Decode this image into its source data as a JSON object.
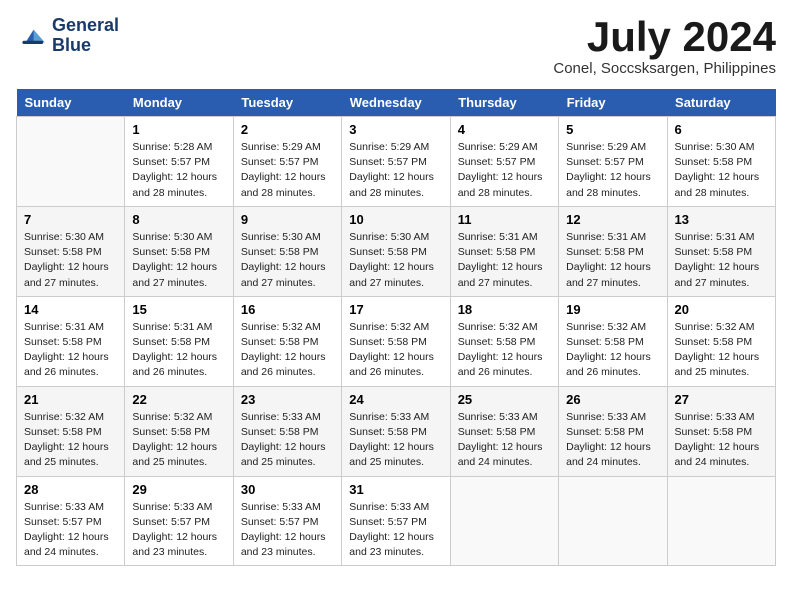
{
  "logo": {
    "line1": "General",
    "line2": "Blue"
  },
  "title": "July 2024",
  "location": "Conel, Soccsksargen, Philippines",
  "days_of_week": [
    "Sunday",
    "Monday",
    "Tuesday",
    "Wednesday",
    "Thursday",
    "Friday",
    "Saturday"
  ],
  "weeks": [
    [
      {
        "day": "",
        "info": ""
      },
      {
        "day": "1",
        "info": "Sunrise: 5:28 AM\nSunset: 5:57 PM\nDaylight: 12 hours\nand 28 minutes."
      },
      {
        "day": "2",
        "info": "Sunrise: 5:29 AM\nSunset: 5:57 PM\nDaylight: 12 hours\nand 28 minutes."
      },
      {
        "day": "3",
        "info": "Sunrise: 5:29 AM\nSunset: 5:57 PM\nDaylight: 12 hours\nand 28 minutes."
      },
      {
        "day": "4",
        "info": "Sunrise: 5:29 AM\nSunset: 5:57 PM\nDaylight: 12 hours\nand 28 minutes."
      },
      {
        "day": "5",
        "info": "Sunrise: 5:29 AM\nSunset: 5:57 PM\nDaylight: 12 hours\nand 28 minutes."
      },
      {
        "day": "6",
        "info": "Sunrise: 5:30 AM\nSunset: 5:58 PM\nDaylight: 12 hours\nand 28 minutes."
      }
    ],
    [
      {
        "day": "7",
        "info": "Sunrise: 5:30 AM\nSunset: 5:58 PM\nDaylight: 12 hours\nand 27 minutes."
      },
      {
        "day": "8",
        "info": "Sunrise: 5:30 AM\nSunset: 5:58 PM\nDaylight: 12 hours\nand 27 minutes."
      },
      {
        "day": "9",
        "info": "Sunrise: 5:30 AM\nSunset: 5:58 PM\nDaylight: 12 hours\nand 27 minutes."
      },
      {
        "day": "10",
        "info": "Sunrise: 5:30 AM\nSunset: 5:58 PM\nDaylight: 12 hours\nand 27 minutes."
      },
      {
        "day": "11",
        "info": "Sunrise: 5:31 AM\nSunset: 5:58 PM\nDaylight: 12 hours\nand 27 minutes."
      },
      {
        "day": "12",
        "info": "Sunrise: 5:31 AM\nSunset: 5:58 PM\nDaylight: 12 hours\nand 27 minutes."
      },
      {
        "day": "13",
        "info": "Sunrise: 5:31 AM\nSunset: 5:58 PM\nDaylight: 12 hours\nand 27 minutes."
      }
    ],
    [
      {
        "day": "14",
        "info": "Sunrise: 5:31 AM\nSunset: 5:58 PM\nDaylight: 12 hours\nand 26 minutes."
      },
      {
        "day": "15",
        "info": "Sunrise: 5:31 AM\nSunset: 5:58 PM\nDaylight: 12 hours\nand 26 minutes."
      },
      {
        "day": "16",
        "info": "Sunrise: 5:32 AM\nSunset: 5:58 PM\nDaylight: 12 hours\nand 26 minutes."
      },
      {
        "day": "17",
        "info": "Sunrise: 5:32 AM\nSunset: 5:58 PM\nDaylight: 12 hours\nand 26 minutes."
      },
      {
        "day": "18",
        "info": "Sunrise: 5:32 AM\nSunset: 5:58 PM\nDaylight: 12 hours\nand 26 minutes."
      },
      {
        "day": "19",
        "info": "Sunrise: 5:32 AM\nSunset: 5:58 PM\nDaylight: 12 hours\nand 26 minutes."
      },
      {
        "day": "20",
        "info": "Sunrise: 5:32 AM\nSunset: 5:58 PM\nDaylight: 12 hours\nand 25 minutes."
      }
    ],
    [
      {
        "day": "21",
        "info": "Sunrise: 5:32 AM\nSunset: 5:58 PM\nDaylight: 12 hours\nand 25 minutes."
      },
      {
        "day": "22",
        "info": "Sunrise: 5:32 AM\nSunset: 5:58 PM\nDaylight: 12 hours\nand 25 minutes."
      },
      {
        "day": "23",
        "info": "Sunrise: 5:33 AM\nSunset: 5:58 PM\nDaylight: 12 hours\nand 25 minutes."
      },
      {
        "day": "24",
        "info": "Sunrise: 5:33 AM\nSunset: 5:58 PM\nDaylight: 12 hours\nand 25 minutes."
      },
      {
        "day": "25",
        "info": "Sunrise: 5:33 AM\nSunset: 5:58 PM\nDaylight: 12 hours\nand 24 minutes."
      },
      {
        "day": "26",
        "info": "Sunrise: 5:33 AM\nSunset: 5:58 PM\nDaylight: 12 hours\nand 24 minutes."
      },
      {
        "day": "27",
        "info": "Sunrise: 5:33 AM\nSunset: 5:58 PM\nDaylight: 12 hours\nand 24 minutes."
      }
    ],
    [
      {
        "day": "28",
        "info": "Sunrise: 5:33 AM\nSunset: 5:57 PM\nDaylight: 12 hours\nand 24 minutes."
      },
      {
        "day": "29",
        "info": "Sunrise: 5:33 AM\nSunset: 5:57 PM\nDaylight: 12 hours\nand 23 minutes."
      },
      {
        "day": "30",
        "info": "Sunrise: 5:33 AM\nSunset: 5:57 PM\nDaylight: 12 hours\nand 23 minutes."
      },
      {
        "day": "31",
        "info": "Sunrise: 5:33 AM\nSunset: 5:57 PM\nDaylight: 12 hours\nand 23 minutes."
      },
      {
        "day": "",
        "info": ""
      },
      {
        "day": "",
        "info": ""
      },
      {
        "day": "",
        "info": ""
      }
    ]
  ]
}
